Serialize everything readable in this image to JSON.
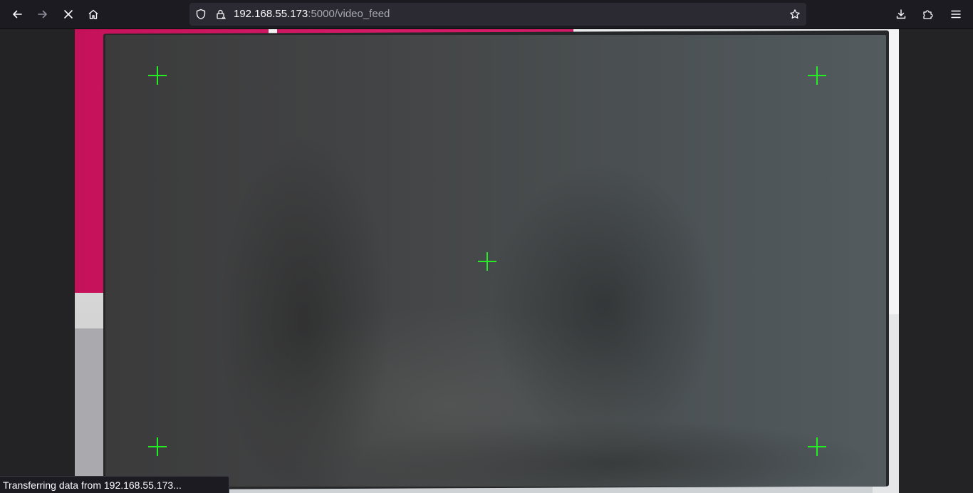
{
  "browser": {
    "url": {
      "host": "192.168.55.173",
      "path": ":5000/video_feed"
    },
    "status_text": "Transferring data from 192.168.55.173...",
    "icons": {
      "back": "arrow-left-icon",
      "forward": "arrow-right-icon",
      "stop": "close-icon",
      "home": "home-icon",
      "tracking": "shield-icon",
      "connection": "insecure-lock-icon",
      "bookmark": "star-icon",
      "downloads": "download-icon",
      "extensions": "puzzle-icon",
      "menu": "hamburger-menu-icon"
    }
  },
  "video_feed": {
    "calibration_marker_color": "#22ee22",
    "calibration_markers": [
      "top-left",
      "top-right",
      "center",
      "bottom-left",
      "bottom-right"
    ]
  }
}
